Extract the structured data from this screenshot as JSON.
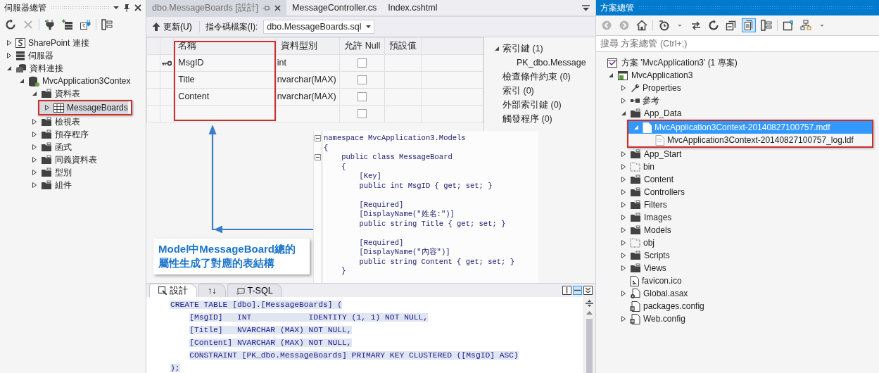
{
  "server_explorer": {
    "title": "伺服器總管",
    "toolbar": [
      {
        "kind": "refresh",
        "disabled": false
      },
      {
        "kind": "delete",
        "disabled": true
      },
      {
        "kind": "connect",
        "disabled": false
      },
      {
        "kind": "add-server",
        "disabled": false
      },
      {
        "kind": "site-connect",
        "disabled": false
      },
      {
        "kind": "properties",
        "disabled": false
      }
    ],
    "tree": [
      {
        "label": "SharePoint 連接",
        "kind": "site",
        "expanded": false,
        "selected": false,
        "highlighted": false
      },
      {
        "label": "伺服器",
        "kind": "server",
        "expanded": false,
        "selected": false,
        "highlighted": false
      },
      {
        "label": "資料連接",
        "kind": "connections",
        "expanded": true,
        "selected": false,
        "highlighted": false,
        "children": [
          {
            "label": "MvcApplication3Contex",
            "kind": "database",
            "expanded": true,
            "selected": false,
            "highlighted": false,
            "children": [
              {
                "label": "資料表",
                "kind": "folder",
                "expanded": true,
                "selected": false,
                "highlighted": false,
                "children": [
                  {
                    "label": "MessageBoards",
                    "kind": "table",
                    "expanded": false,
                    "selected": true,
                    "highlighted": true
                  }
                ]
              },
              {
                "label": "檢視表",
                "kind": "folder",
                "expanded": false,
                "selected": false,
                "highlighted": false
              },
              {
                "label": "預存程序",
                "kind": "folder",
                "expanded": false,
                "selected": false,
                "highlighted": false
              },
              {
                "label": "函式",
                "kind": "folder",
                "expanded": false,
                "selected": false,
                "highlighted": false
              },
              {
                "label": "同義資料表",
                "kind": "folder",
                "expanded": false,
                "selected": false,
                "highlighted": false
              },
              {
                "label": "型別",
                "kind": "folder",
                "expanded": false,
                "selected": false,
                "highlighted": false
              },
              {
                "label": "組件",
                "kind": "folder",
                "expanded": false,
                "selected": false,
                "highlighted": false
              }
            ]
          }
        ]
      }
    ]
  },
  "document_tabs": [
    {
      "label": "dbo.MessageBoards [設計]",
      "selected": true
    },
    {
      "label": "MessageController.cs",
      "selected": false
    },
    {
      "label": "Index.cshtml",
      "selected": false
    }
  ],
  "designer_toolbar": {
    "update_button": "更新(U)",
    "script_label": "指令碼檔案(I):",
    "script_file": "dbo.MessageBoards.sql"
  },
  "table_designer": {
    "columns": [
      {
        "label": "名稱",
        "highlighted": true
      },
      {
        "label": "資料型別",
        "highlighted": false
      },
      {
        "label": "允許 Null",
        "highlighted": false
      },
      {
        "label": "預設值",
        "highlighted": false
      }
    ],
    "rows": [
      {
        "primary_key": true,
        "name": "MsgID",
        "type": "int",
        "allow_null": false
      },
      {
        "primary_key": false,
        "name": "Title",
        "type": "nvarchar(MAX)",
        "allow_null": false
      },
      {
        "primary_key": false,
        "name": "Content",
        "type": "nvarchar(MAX)",
        "allow_null": false
      },
      {
        "primary_key": false,
        "allow_null": false
      }
    ]
  },
  "table_properties": [
    {
      "label": "索引鍵 (1)",
      "expanded": true,
      "children": [
        {
          "label": "PK_dbo.Message"
        }
      ]
    },
    {
      "label": "檢查條件約束 (0)"
    },
    {
      "label": "索引 (0)"
    },
    {
      "label": "外部索引鍵 (0)"
    },
    {
      "label": "觸發程序 (0)"
    }
  ],
  "code_snippet": {
    "blocks": [
      [
        "namespace MvcApplication3.Models",
        "{",
        "    public class MessageBoard",
        "    {",
        "        [Key]",
        "        public int MsgID { get; set; }"
      ],
      [
        "        [Required]",
        "        [DisplayName(\"姓名:\")]",
        "        public string Title { get; set; }"
      ],
      [
        "        [Required]",
        "        [DisplayName(\"內容\")]",
        "        public string Content { get; set; }",
        "    }"
      ]
    ]
  },
  "annotation": {
    "text": "Model中MessageBoard總的屬性生成了對應的表結構"
  },
  "bottom_tabs": [
    {
      "label": "設計",
      "kind": "design",
      "selected": true
    },
    {
      "label": "↑↓",
      "kind": "swap",
      "selected": false
    },
    {
      "label": "T-SQL",
      "kind": "sql",
      "selected": false
    }
  ],
  "sql_lines": [
    "CREATE TABLE [dbo].[MessageBoards] (",
    "    [MsgID]   INT            IDENTITY (1, 1) NOT NULL,",
    "    [Title]   NVARCHAR (MAX) NOT NULL,",
    "    [Content] NVARCHAR (MAX) NOT NULL,",
    "    CONSTRAINT [PK_dbo.MessageBoards] PRIMARY KEY CLUSTERED ([MsgID] ASC)",
    ");"
  ],
  "solution_explorer": {
    "title": "方案總管",
    "toolbar": [
      {
        "kind": "back",
        "selected": false
      },
      {
        "kind": "forward",
        "selected": false
      },
      {
        "kind": "home",
        "selected": false
      },
      {
        "kind": "history",
        "selected": false
      },
      {
        "kind": "caret",
        "selected": false
      },
      {
        "kind": "sync",
        "selected": false
      },
      {
        "kind": "refresh",
        "selected": false
      },
      {
        "kind": "collapse",
        "selected": false
      },
      {
        "kind": "show-all",
        "selected": true
      },
      {
        "kind": "properties",
        "selected": false
      },
      {
        "kind": "preview",
        "selected": false
      },
      {
        "kind": "diagram",
        "selected": false
      },
      {
        "kind": "caret",
        "selected": false
      }
    ],
    "search": {
      "placeholder": "搜尋 方案總管 (Ctrl+;)"
    },
    "solution": {
      "label": "方案 'MvcApplication3' (1 專案)"
    },
    "tree": [
      {
        "label": "MvcApplication3",
        "kind": "project",
        "expanded": true,
        "selected": false,
        "highlighted": false,
        "children": [
          {
            "label": "Properties",
            "kind": "wrench",
            "expanded": false,
            "selected": false,
            "highlighted": false
          },
          {
            "label": "參考",
            "kind": "references",
            "expanded": false,
            "selected": false,
            "highlighted": false
          },
          {
            "label": "App_Data",
            "kind": "folder",
            "expanded": true,
            "selected": false,
            "highlighted": false,
            "children": [
              {
                "label": "MvcApplication3Context-20140827100757.mdf",
                "kind": "file",
                "expanded": true,
                "selected": true,
                "highlighted": true,
                "children": [
                  {
                    "label": "MvcApplication3Context-20140827100757_log.ldf",
                    "kind": "ghost-file",
                    "selected": false,
                    "highlighted": false
                  }
                ]
              }
            ]
          },
          {
            "label": "App_Start",
            "kind": "folder",
            "expanded": false,
            "selected": false,
            "highlighted": false
          },
          {
            "label": "bin",
            "kind": "dotted-folder",
            "expanded": false,
            "selected": false,
            "highlighted": false
          },
          {
            "label": "Content",
            "kind": "folder",
            "expanded": false,
            "selected": false,
            "highlighted": false
          },
          {
            "label": "Controllers",
            "kind": "folder",
            "expanded": false,
            "selected": false,
            "highlighted": false
          },
          {
            "label": "Filters",
            "kind": "folder",
            "expanded": false,
            "selected": false,
            "highlighted": false
          },
          {
            "label": "Images",
            "kind": "folder",
            "expanded": false,
            "selected": false,
            "highlighted": false
          },
          {
            "label": "Models",
            "kind": "folder",
            "expanded": false,
            "selected": false,
            "highlighted": false
          },
          {
            "label": "obj",
            "kind": "dotted-folder",
            "expanded": false,
            "selected": false,
            "highlighted": false
          },
          {
            "label": "Scripts",
            "kind": "folder",
            "expanded": false,
            "selected": false,
            "highlighted": false
          },
          {
            "label": "Views",
            "kind": "folder",
            "expanded": false,
            "selected": false,
            "highlighted": false
          },
          {
            "label": "favicon.ico",
            "kind": "image-file",
            "selected": false,
            "highlighted": false
          },
          {
            "label": "Global.asax",
            "kind": "gear-file",
            "expanded": false,
            "selected": false,
            "highlighted": false
          },
          {
            "label": "packages.config",
            "kind": "config",
            "selected": false,
            "highlighted": false
          },
          {
            "label": "Web.config",
            "kind": "config",
            "expanded": false,
            "selected": false,
            "highlighted": false
          }
        ]
      }
    ]
  }
}
